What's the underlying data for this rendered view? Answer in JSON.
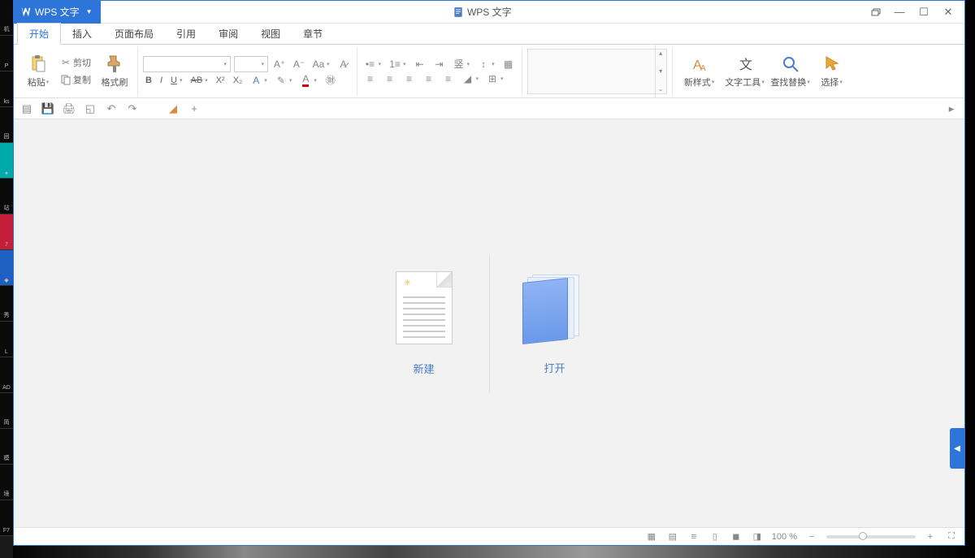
{
  "app": {
    "badge": "WPS 文字",
    "title": "WPS 文字"
  },
  "menu": {
    "items": [
      "开始",
      "插入",
      "页面布局",
      "引用",
      "审阅",
      "视图",
      "章节"
    ],
    "active_index": 0
  },
  "ribbon": {
    "clipboard": {
      "paste": "粘贴",
      "cut": "剪切",
      "copy": "复制",
      "format_painter": "格式刷"
    },
    "font": {
      "bold": "B",
      "italic": "I",
      "underline": "U",
      "strike": "AB",
      "super": "X²",
      "sub": "X₂"
    },
    "right": {
      "new_style": "新样式",
      "text_tools": "文字工具",
      "find_replace": "查找替换",
      "select": "选择"
    }
  },
  "start": {
    "new": "新建",
    "open": "打开"
  },
  "status": {
    "zoom": "100 %"
  },
  "sidetab": "◀"
}
